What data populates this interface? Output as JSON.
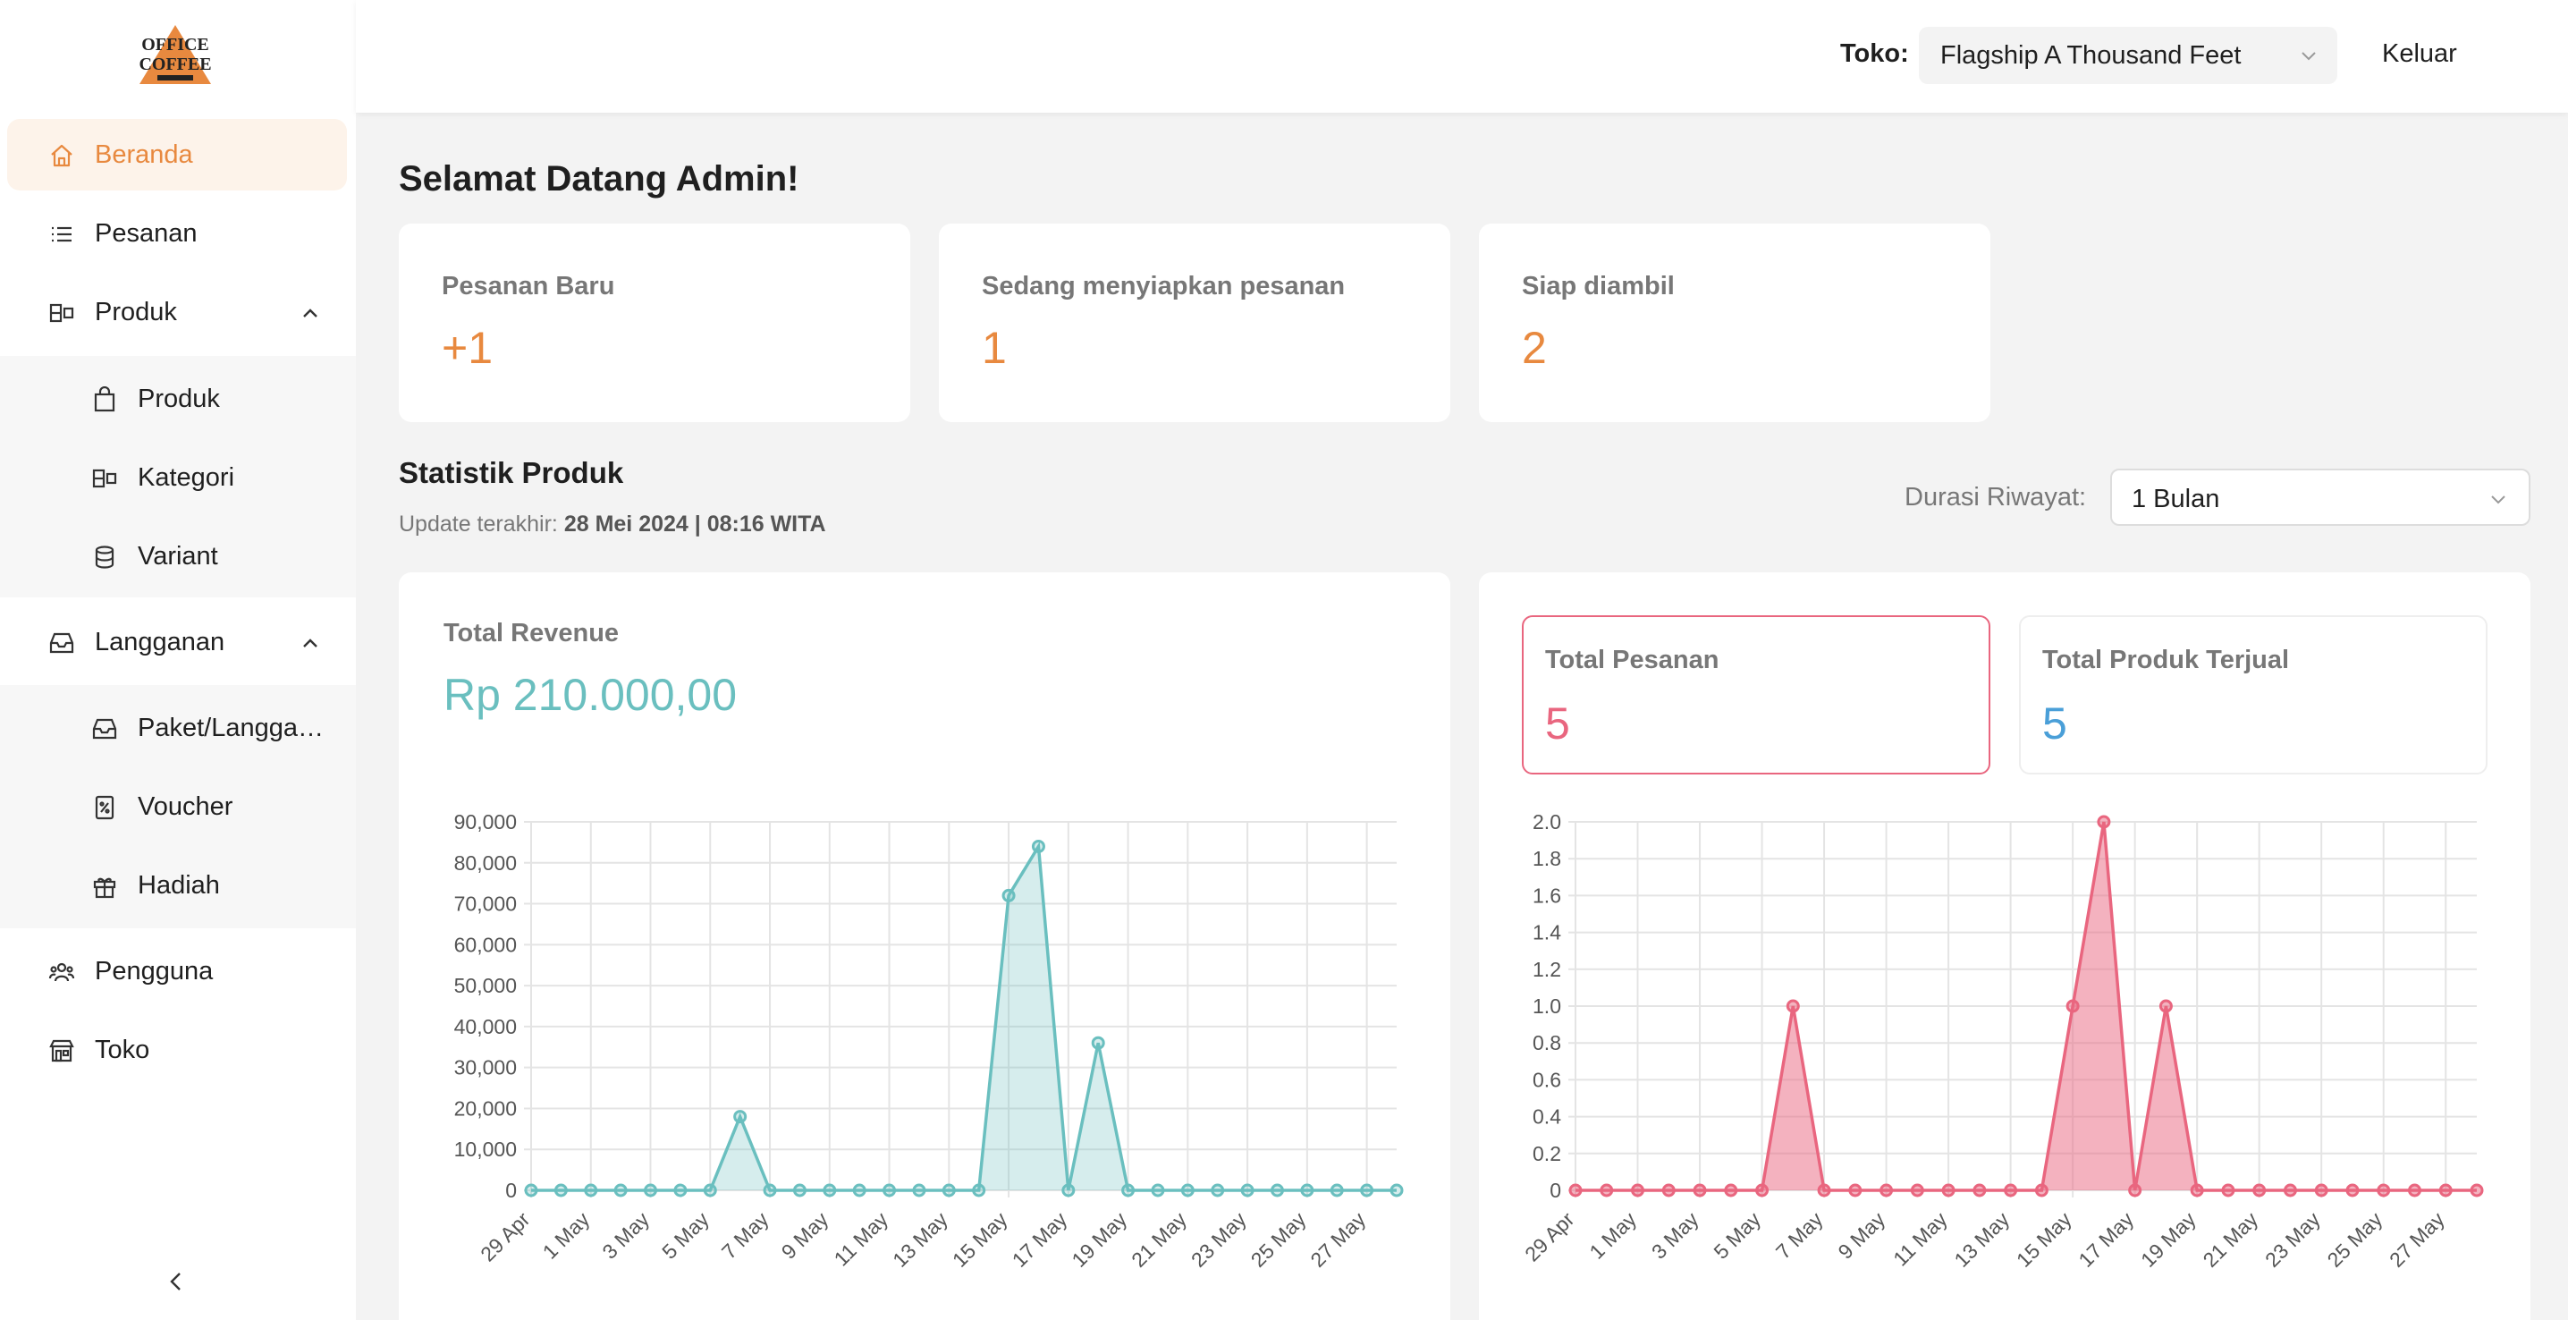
{
  "sidebar": {
    "logo_text": "OFFICE COFFEE",
    "items": [
      {
        "label": "Beranda"
      },
      {
        "label": "Pesanan"
      },
      {
        "label": "Produk"
      },
      {
        "label": "Langganan"
      },
      {
        "label": "Pengguna"
      },
      {
        "label": "Toko"
      }
    ],
    "produk_sub": [
      {
        "label": "Produk"
      },
      {
        "label": "Kategori"
      },
      {
        "label": "Variant"
      }
    ],
    "langganan_sub": [
      {
        "label": "Paket/Langganan"
      },
      {
        "label": "Voucher"
      },
      {
        "label": "Hadiah"
      }
    ]
  },
  "header": {
    "store_label": "Toko:",
    "store_value": "Flagship A Thousand Feet",
    "logout": "Keluar"
  },
  "main": {
    "welcome": "Selamat Datang Admin!",
    "stats": [
      {
        "title": "Pesanan Baru",
        "value": "+1"
      },
      {
        "title": "Sedang menyiapkan pesanan",
        "value": "1"
      },
      {
        "title": "Siap diambil",
        "value": "2"
      }
    ],
    "section_title": "Statistik Produk",
    "updated_label": "Update terakhir:",
    "updated_value": "28 Mei 2024 | 08:16 WITA",
    "duration_label": "Durasi Riwayat:",
    "duration_value": "1 Bulan",
    "revenue_title": "Total Revenue",
    "revenue_value": "Rp 210.000,00",
    "orders_title": "Total Pesanan",
    "orders_value": "5",
    "sold_title": "Total Produk Terjual",
    "sold_value": "5"
  },
  "colors": {
    "accent": "#e8893f",
    "revenue": "#6abfbf",
    "orders": "#e9667f",
    "sold": "#4a9fd8"
  },
  "chart_data": [
    {
      "type": "area",
      "title": "",
      "x": [
        "29 Apr",
        "30 Apr",
        "1 May",
        "2 May",
        "3 May",
        "4 May",
        "5 May",
        "6 May",
        "7 May",
        "8 May",
        "9 May",
        "10 May",
        "11 May",
        "12 May",
        "13 May",
        "14 May",
        "15 May",
        "16 May",
        "17 May",
        "18 May",
        "19 May",
        "20 May",
        "21 May",
        "22 May",
        "23 May",
        "24 May",
        "25 May",
        "26 May",
        "27 May",
        "28 May"
      ],
      "xticks": [
        "29 Apr",
        "1 May",
        "3 May",
        "5 May",
        "7 May",
        "9 May",
        "11 May",
        "13 May",
        "15 May",
        "17 May",
        "19 May",
        "21 May",
        "23 May",
        "25 May",
        "27 May"
      ],
      "series": [
        {
          "values": [
            0,
            0,
            0,
            0,
            0,
            0,
            0,
            18000,
            0,
            0,
            0,
            0,
            0,
            0,
            0,
            0,
            72000,
            84000,
            0,
            36000,
            0,
            0,
            0,
            0,
            0,
            0,
            0,
            0,
            0,
            0
          ]
        }
      ],
      "ylim": [
        0,
        90000
      ],
      "yticks": [
        "0",
        "10,000",
        "20,000",
        "30,000",
        "40,000",
        "50,000",
        "60,000",
        "70,000",
        "80,000",
        "90,000"
      ],
      "grid": true
    },
    {
      "type": "area",
      "title": "",
      "x": [
        "29 Apr",
        "30 Apr",
        "1 May",
        "2 May",
        "3 May",
        "4 May",
        "5 May",
        "6 May",
        "7 May",
        "8 May",
        "9 May",
        "10 May",
        "11 May",
        "12 May",
        "13 May",
        "14 May",
        "15 May",
        "16 May",
        "17 May",
        "18 May",
        "19 May",
        "20 May",
        "21 May",
        "22 May",
        "23 May",
        "24 May",
        "25 May",
        "26 May",
        "27 May",
        "28 May"
      ],
      "xticks": [
        "29 Apr",
        "1 May",
        "3 May",
        "5 May",
        "7 May",
        "9 May",
        "11 May",
        "13 May",
        "15 May",
        "17 May",
        "19 May",
        "21 May",
        "23 May",
        "25 May",
        "27 May"
      ],
      "series": [
        {
          "values": [
            0,
            0,
            0,
            0,
            0,
            0,
            0,
            1,
            0,
            0,
            0,
            0,
            0,
            0,
            0,
            0,
            1,
            2,
            0,
            1,
            0,
            0,
            0,
            0,
            0,
            0,
            0,
            0,
            0,
            0
          ]
        }
      ],
      "ylim": [
        0,
        2.0
      ],
      "yticks": [
        "0",
        "0.2",
        "0.4",
        "0.6",
        "0.8",
        "1.0",
        "1.2",
        "1.4",
        "1.6",
        "1.8",
        "2.0"
      ],
      "grid": true
    }
  ]
}
